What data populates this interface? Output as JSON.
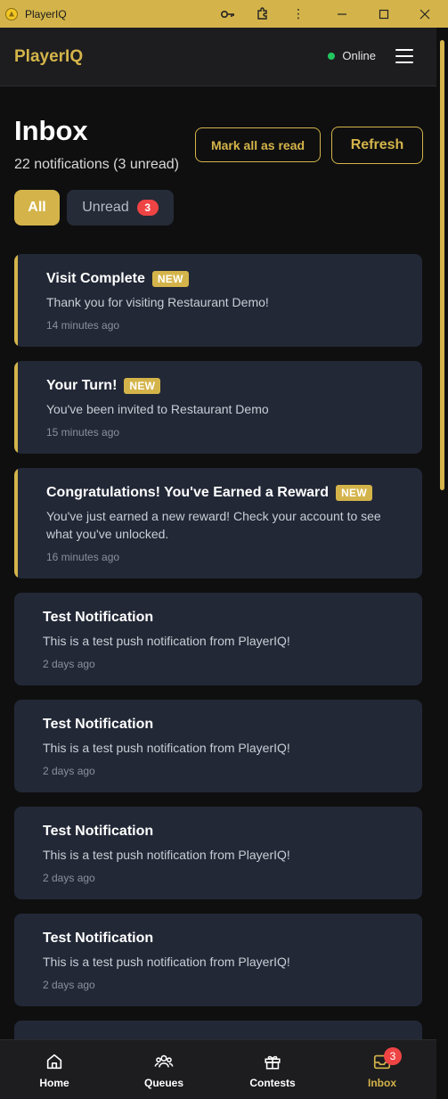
{
  "window": {
    "title": "PlayerIQ"
  },
  "header": {
    "brand": "PlayerIQ",
    "status": "Online"
  },
  "inbox": {
    "title": "Inbox",
    "subtitle": "22 notifications (3 unread)",
    "mark_all_label": "Mark all as read",
    "refresh_label": "Refresh",
    "filters": {
      "all_label": "All",
      "unread_label": "Unread",
      "unread_count": "3"
    }
  },
  "notifications": [
    {
      "title": "Visit Complete",
      "badge": "NEW",
      "body": "Thank you for visiting Restaurant Demo!",
      "time": "14 minutes ago"
    },
    {
      "title": "Your Turn!",
      "badge": "NEW",
      "body": "You've been invited to Restaurant Demo",
      "time": "15 minutes ago"
    },
    {
      "title": "Congratulations! You've Earned a Reward",
      "badge": "NEW",
      "body": "You've just earned a new reward! Check your account to see what you've unlocked.",
      "time": "16 minutes ago"
    },
    {
      "title": "Test Notification",
      "body": "This is a test push notification from PlayerIQ!",
      "time": "2 days ago"
    },
    {
      "title": "Test Notification",
      "body": "This is a test push notification from PlayerIQ!",
      "time": "2 days ago"
    },
    {
      "title": "Test Notification",
      "body": "This is a test push notification from PlayerIQ!",
      "time": "2 days ago"
    },
    {
      "title": "Test Notification",
      "body": "This is a test push notification from PlayerIQ!",
      "time": "2 days ago"
    }
  ],
  "bottom_nav": {
    "home": "Home",
    "queues": "Queues",
    "contests": "Contests",
    "inbox": "Inbox",
    "inbox_badge": "3"
  },
  "colors": {
    "accent": "#d4b44a",
    "card": "#222836",
    "badge_red": "#ef4444",
    "online": "#22c55e"
  }
}
